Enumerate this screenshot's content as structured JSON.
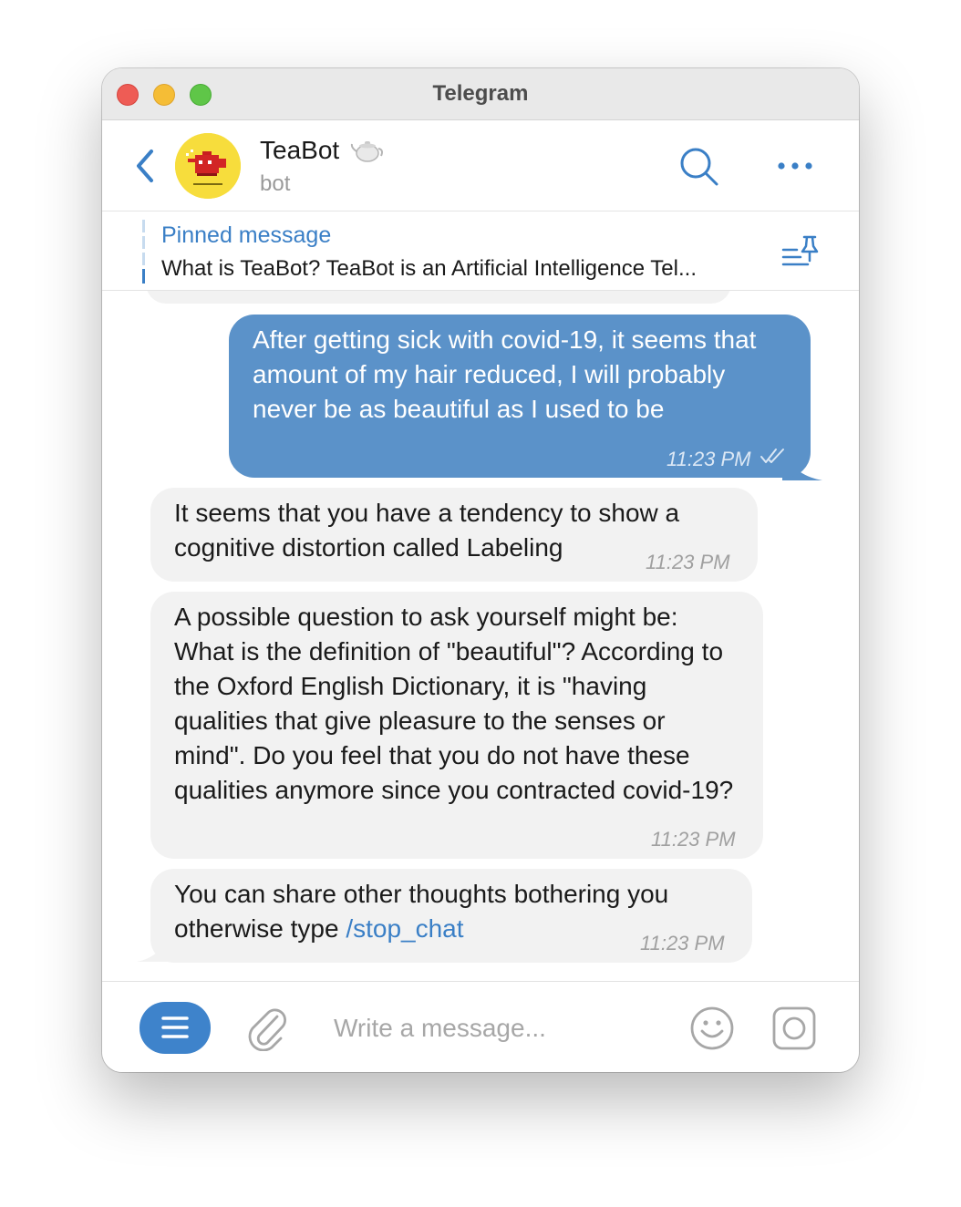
{
  "window": {
    "title": "Telegram"
  },
  "header": {
    "name": "TeaBot",
    "status": "bot",
    "avatar_icon": "teapot-logo",
    "name_emoji_icon": "teapot-icon"
  },
  "pinned": {
    "title": "Pinned message",
    "text": "What is TeaBot?  TeaBot is an Artificial Intelligence Tel..."
  },
  "messages": [
    {
      "direction": "out",
      "text": "After getting sick with covid-19, it seems that amount of my hair reduced, I will probably never be as beautiful as I used to be",
      "time": "11:23 PM",
      "read": true
    },
    {
      "direction": "in",
      "text": "It seems that you have a tendency to show a cognitive distortion called Labeling",
      "time": "11:23 PM"
    },
    {
      "direction": "in",
      "text": "A possible question to ask yourself might be: What is the definition of \"beautiful\"? According to the Oxford English Dictionary, it is \"having qualities that give pleasure to the senses or mind\". Do you feel that you do not have these qualities anymore since you contracted covid-19?",
      "time": "11:23 PM"
    },
    {
      "direction": "in",
      "text_before_link": "You can share other thoughts bothering you otherwise type ",
      "link": "/stop_chat",
      "time": "11:23 PM"
    }
  ],
  "composer": {
    "placeholder": "Write a message..."
  },
  "colors": {
    "accent": "#3a7fc6",
    "outgoing_bubble": "#5b92c9",
    "incoming_bubble": "#f2f2f2"
  }
}
